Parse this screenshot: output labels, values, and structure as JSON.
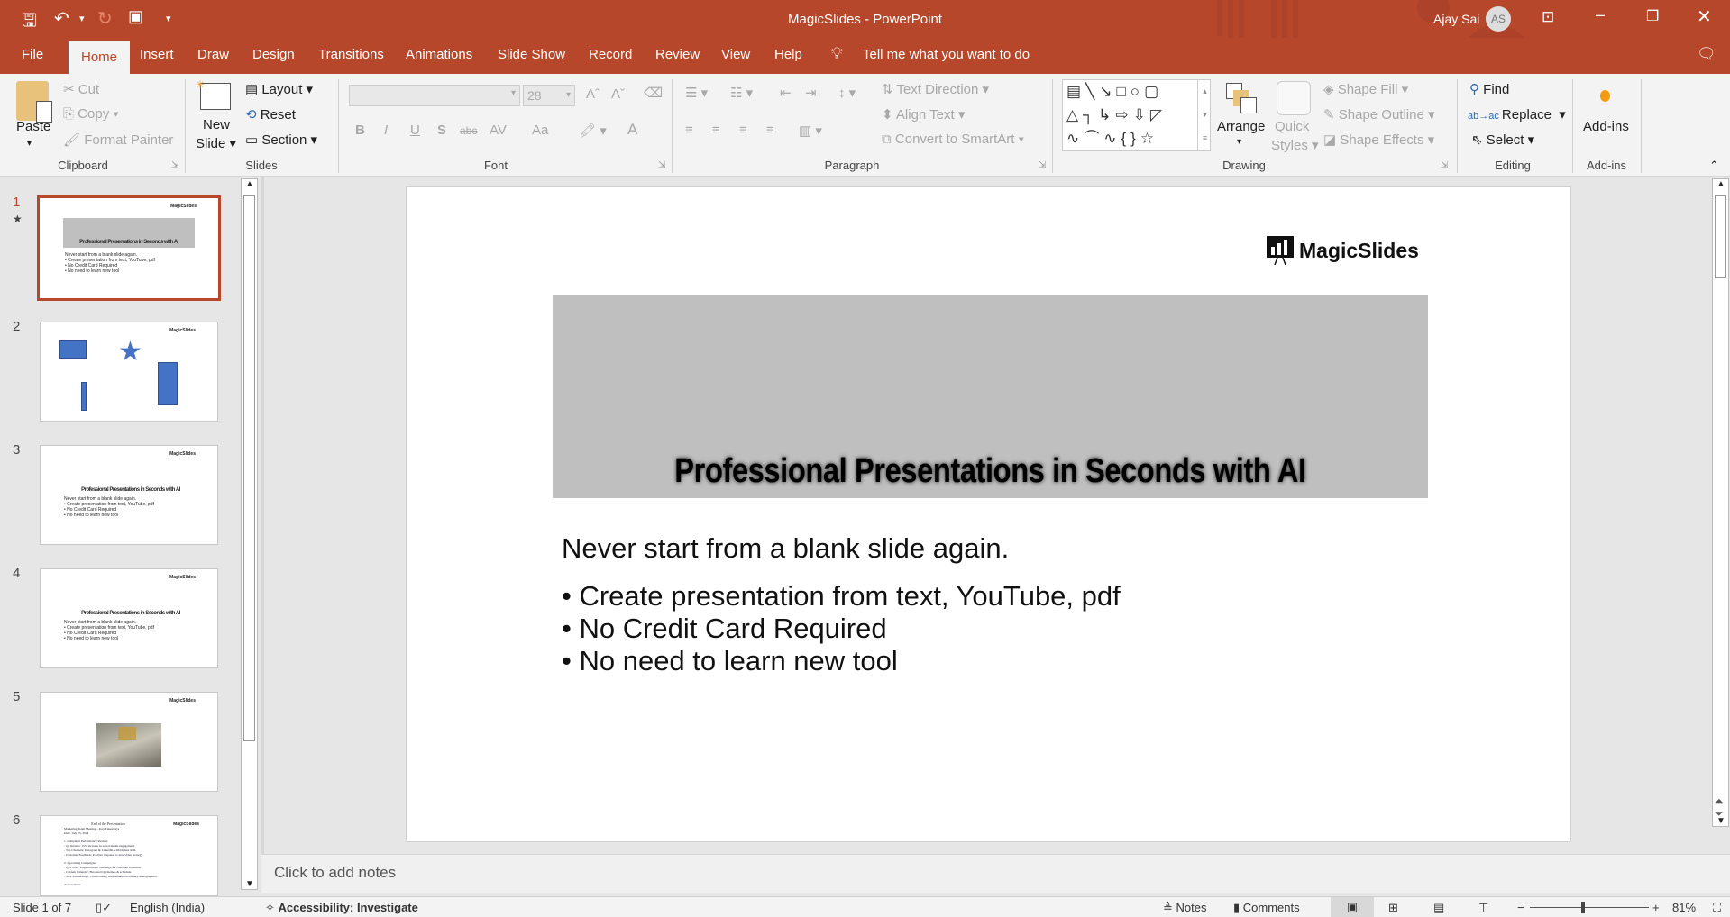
{
  "app": {
    "title": "MagicSlides  -  PowerPoint",
    "user_name": "Ajay Sai",
    "user_initials": "AS"
  },
  "tabs": [
    "File",
    "Home",
    "Insert",
    "Draw",
    "Design",
    "Transitions",
    "Animations",
    "Slide Show",
    "Record",
    "Review",
    "View",
    "Help"
  ],
  "tell_me": "Tell me what you want to do",
  "ribbon": {
    "clipboard": {
      "paste": "Paste",
      "cut": "Cut",
      "copy": "Copy",
      "format_painter": "Format Painter",
      "label": "Clipboard"
    },
    "slides": {
      "new_slide_1": "New",
      "new_slide_2": "Slide",
      "layout": "Layout",
      "reset": "Reset",
      "section": "Section",
      "label": "Slides"
    },
    "font": {
      "font_name": "",
      "font_size": "28",
      "bold": "B",
      "italic": "I",
      "underline": "U",
      "shadow": "S",
      "strike": "abc",
      "spacing": "AV",
      "case": "Aa",
      "color": "A",
      "grow": "Aˆ",
      "shrink": "Aˇ",
      "label": "Font"
    },
    "paragraph": {
      "text_direction": "Text Direction",
      "align_text": "Align Text",
      "smartart": "Convert to SmartArt",
      "label": "Paragraph"
    },
    "drawing": {
      "arrange": "Arrange",
      "quick_styles_1": "Quick",
      "quick_styles_2": "Styles",
      "shape_fill": "Shape Fill",
      "shape_outline": "Shape Outline",
      "shape_effects": "Shape Effects",
      "label": "Drawing"
    },
    "editing": {
      "find": "Find",
      "replace": "Replace",
      "select": "Select",
      "label": "Editing"
    },
    "addins": {
      "button": "Add-ins",
      "label": "Add-ins"
    }
  },
  "thumbnails": [
    {
      "num": "1",
      "logo": "MagicSlides",
      "title": "Professional Presentations in Seconds with AI",
      "lines": [
        "Never start from a blank slide again.",
        "• Create presentation from text, YouTube, pdf",
        "• No Credit Card Required",
        "• No need to learn new tool"
      ]
    },
    {
      "num": "2",
      "logo": "MagicSlides"
    },
    {
      "num": "3",
      "logo": "MagicSlides",
      "title": "Professional Presentations in Seconds with AI",
      "lines": [
        "Never start from a blank slide again.",
        "• Create presentation from text, YouTube, pdf",
        "• No Credit Card Required",
        "• No need to learn new tool"
      ]
    },
    {
      "num": "4",
      "logo": "MagicSlides",
      "title": "Professional Presentations in Seconds with AI",
      "lines": [
        "Never start from a blank slide again.",
        "• Create presentation from text, YouTube, pdf",
        "• No Credit Card Required",
        "• No need to learn new tool"
      ]
    },
    {
      "num": "5",
      "logo": "MagicSlides"
    },
    {
      "num": "6",
      "logo": "MagicSlides",
      "title": "End of the Presentation",
      "lines": [
        "Marketing Team Meeting – Key Takeaways",
        "Date: July 25, 2024",
        "1. Campaign Performance Review:",
        "- Q2 Results: 15% increase in social media engagement.",
        "- Top Channels: Instagram & LinkedIn with highest ROI.",
        "- Customer Feedback: Positive response to new video strategy.",
        "2. Upcoming Campaigns:",
        "- Q3 Focus: Targeted email campaign for customer retention.",
        "- Content Calendar: Finalized Q3 themes & schedule.",
        "- New Partnerships: Collaborating with influencers for key demographics.",
        "Action Items:"
      ]
    }
  ],
  "slide": {
    "logo": "MagicSlides",
    "title": "Professional Presentations in Seconds with AI",
    "subtitle": "Never start from a blank slide again.",
    "bullets": [
      "• Create presentation from text, YouTube, pdf",
      "• No Credit Card Required",
      "• No need to learn new tool"
    ]
  },
  "notes_placeholder": "Click to add notes",
  "status": {
    "slide_pos": "Slide 1 of 7",
    "language": "English (India)",
    "accessibility": "Accessibility: Investigate",
    "notes": "Notes",
    "comments": "Comments",
    "zoom": "81%",
    "zoom_fraction": 0.45
  },
  "colors": {
    "accent": "#B7472A",
    "ribbon": "#F3F3F3"
  }
}
